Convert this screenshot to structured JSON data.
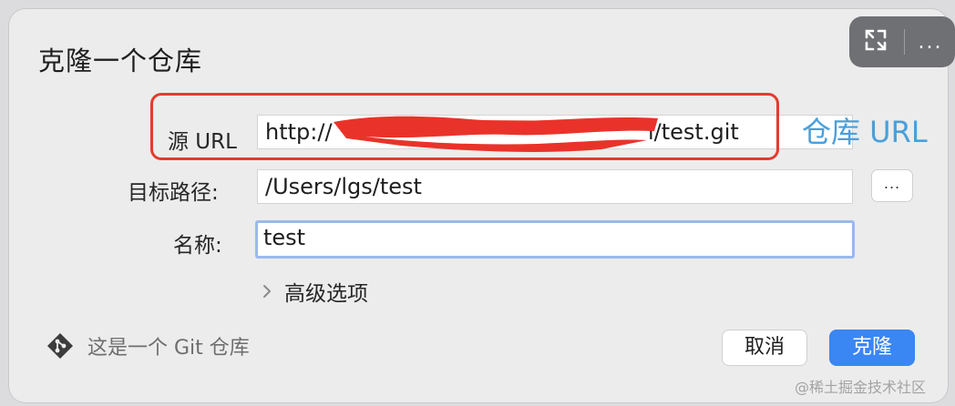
{
  "dialog": {
    "title": "克隆一个仓库",
    "source_url": {
      "label": "源 URL",
      "value": "http://",
      "value_tail": "l/test.git"
    },
    "annotation": "仓库 URL",
    "target_path": {
      "label": "目标路径:",
      "value": "/Users/lgs/test",
      "browse_label": "..."
    },
    "name": {
      "label": "名称:",
      "value": "test"
    },
    "advanced_label": "高级选项",
    "git_status": "这是一个 Git 仓库",
    "cancel_label": "取消",
    "clone_label": "克隆"
  },
  "toolbar": {
    "more_label": "..."
  },
  "watermark": "@稀土掘金技术社区",
  "colors": {
    "accent": "#3a86f3",
    "annotation_red": "#e23c2e",
    "annotation_blue": "#4b9fd9",
    "focus_ring": "#9ab9ec"
  },
  "icons": [
    "expand-icon",
    "more-icon",
    "chevron-right-icon",
    "git-icon"
  ]
}
